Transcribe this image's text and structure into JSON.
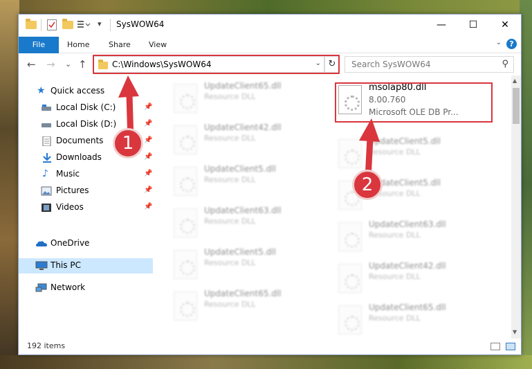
{
  "window": {
    "title": "SysWOW64",
    "minimize": "—",
    "maximize": "☐",
    "close": "✕"
  },
  "ribbon": {
    "file": "File",
    "home": "Home",
    "share": "Share",
    "view": "View",
    "help": "?"
  },
  "nav": {
    "back": "←",
    "forward": "→",
    "recent": "⌄",
    "up": "↑",
    "address": "C:\\Windows\\SysWOW64",
    "refresh": "↻",
    "search_placeholder": "Search SysWOW64"
  },
  "sidebar": {
    "items": [
      {
        "label": "Quick access",
        "icon": "star-icon"
      },
      {
        "label": "Local Disk (C:)",
        "icon": "drive-c-icon"
      },
      {
        "label": "Local Disk (D:)",
        "icon": "drive-d-icon"
      },
      {
        "label": "Documents",
        "icon": "documents-icon"
      },
      {
        "label": "Downloads",
        "icon": "downloads-icon"
      },
      {
        "label": "Music",
        "icon": "music-icon"
      },
      {
        "label": "Pictures",
        "icon": "pictures-icon"
      },
      {
        "label": "Videos",
        "icon": "videos-icon"
      },
      {
        "label": "OneDrive",
        "icon": "onedrive-icon"
      },
      {
        "label": "This PC",
        "icon": "this-pc-icon"
      },
      {
        "label": "Network",
        "icon": "network-icon"
      }
    ]
  },
  "files": {
    "left": [
      {
        "name": "UpdateClient65.dll",
        "type": "Resource DLL"
      },
      {
        "name": "UpdateClient42.dll",
        "type": "Resource DLL"
      },
      {
        "name": "UpdateClient5.dll",
        "type": "Resource DLL"
      },
      {
        "name": "UpdateClient63.dll",
        "type": "Resource DLL"
      },
      {
        "name": "UpdateClient5.dll",
        "type": "Resource DLL"
      },
      {
        "name": "UpdateClient65.dll",
        "type": "Resource DLL"
      }
    ],
    "right": [
      {
        "name": "UpdateClient5.dll",
        "type": "Resource DLL"
      },
      {
        "name": "UpdateClient5.dll",
        "type": "Resource DLL"
      },
      {
        "name": "UpdateClient63.dll",
        "type": "Resource DLL"
      },
      {
        "name": "UpdateClient42.dll",
        "type": "Resource DLL"
      },
      {
        "name": "UpdateClient65.dll",
        "type": "Resource DLL"
      }
    ],
    "highlighted": {
      "name": "msolap80.dll",
      "version": "8.00.760",
      "description": "Microsoft OLE DB Pr..."
    }
  },
  "status": {
    "count": "192 items"
  },
  "annotations": {
    "step1": "1",
    "step2": "2"
  },
  "colors": {
    "accent": "#1979ca",
    "highlight": "#d9363e",
    "selected": "#cce8ff"
  }
}
